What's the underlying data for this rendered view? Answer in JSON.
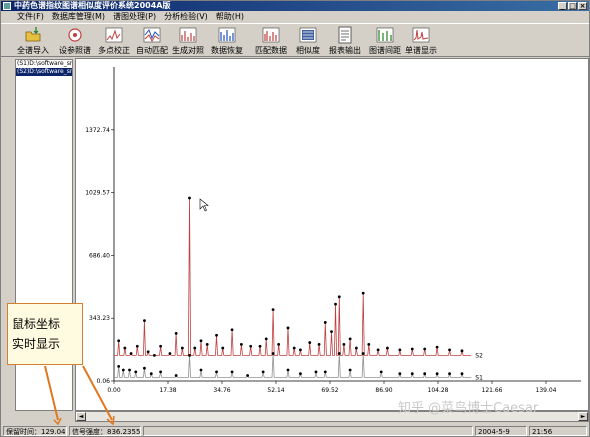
{
  "window": {
    "title": "中药色谱指纹图谱相似度评价系统2004A版"
  },
  "menu": [
    "文件(F)",
    "数据库管理(M)",
    "谱图处理(P)",
    "分析检验(V)",
    "帮助(H)"
  ],
  "toolbar": [
    {
      "label": "全谱导入",
      "icon": "import-icon"
    },
    {
      "label": "设参照谱",
      "icon": "reference-icon"
    },
    {
      "label": "多点校正",
      "icon": "multipoint-correction-icon"
    },
    {
      "label": "自动匹配",
      "icon": "auto-match-icon"
    },
    {
      "label": "生成对照",
      "icon": "generate-reference-icon"
    },
    {
      "label": "数据恢复",
      "icon": "data-restore-icon"
    },
    {
      "label": "匹配数据",
      "icon": "match-data-icon"
    },
    {
      "label": "相似度",
      "icon": "similarity-icon"
    },
    {
      "label": "报表输出",
      "icon": "report-output-icon"
    },
    {
      "label": "图谱间距",
      "icon": "spectrum-spacing-icon"
    },
    {
      "label": "单谱显示",
      "icon": "single-spectrum-icon"
    }
  ],
  "files": [
    "(S1)D:\\software_sr",
    "(S2)D:\\software_sr"
  ],
  "status": {
    "retention_time_label": "保留时间：",
    "retention_time": "129.0429",
    "signal_label": "信号强度：",
    "signal": "836.2355",
    "date": "2004-5-9",
    "time": "21:56"
  },
  "callout": {
    "line1": "鼠标坐标",
    "line2": "实时显示"
  },
  "watermark": "知乎 @菜鸟博士Caesar",
  "colors": {
    "s2_line": "#c04040",
    "s1_line": "#909090",
    "accent": "#0a246a"
  },
  "chart_data": {
    "type": "line",
    "xlabel": "",
    "ylabel": "",
    "x_ticks": [
      "0.00",
      "17.38",
      "34.76",
      "52.14",
      "69.52",
      "86.90",
      "104.28",
      "121.66",
      "139.04"
    ],
    "y_ticks": [
      "0.06",
      "343.23",
      "686.40",
      "1029.57",
      "1372.74"
    ],
    "xlim": [
      0,
      139.04
    ],
    "ylim": [
      0.06,
      1716
    ],
    "series": [
      {
        "name": "S2",
        "peaks": [
          [
            1.5,
            220
          ],
          [
            3.5,
            180
          ],
          [
            5.5,
            150
          ],
          [
            7.5,
            190
          ],
          [
            9.8,
            330
          ],
          [
            11,
            160
          ],
          [
            13,
            140
          ],
          [
            15,
            190
          ],
          [
            18,
            150
          ],
          [
            20,
            260
          ],
          [
            22,
            180
          ],
          [
            24.3,
            1000
          ],
          [
            26,
            180
          ],
          [
            28,
            220
          ],
          [
            30,
            200
          ],
          [
            33,
            250
          ],
          [
            35,
            180
          ],
          [
            38,
            280
          ],
          [
            41,
            200
          ],
          [
            44,
            190
          ],
          [
            47,
            190
          ],
          [
            49,
            230
          ],
          [
            51.2,
            390
          ],
          [
            53,
            200
          ],
          [
            56,
            290
          ],
          [
            58,
            180
          ],
          [
            60,
            170
          ],
          [
            63,
            210
          ],
          [
            66,
            200
          ],
          [
            68,
            320
          ],
          [
            70,
            270
          ],
          [
            71.3,
            420
          ],
          [
            72.5,
            460
          ],
          [
            74,
            200
          ],
          [
            76,
            230
          ],
          [
            78,
            180
          ],
          [
            80.2,
            480
          ],
          [
            82,
            200
          ],
          [
            85,
            170
          ],
          [
            88,
            180
          ],
          [
            92,
            170
          ],
          [
            96,
            175
          ],
          [
            100,
            175
          ],
          [
            104,
            185
          ],
          [
            108,
            170
          ],
          [
            112,
            165
          ]
        ],
        "baseline": 140
      },
      {
        "name": "S1",
        "peaks": [
          [
            1.5,
            80
          ],
          [
            3,
            60
          ],
          [
            5,
            60
          ],
          [
            7,
            50
          ],
          [
            9.8,
            70
          ],
          [
            12,
            40
          ],
          [
            15,
            50
          ],
          [
            20,
            30
          ],
          [
            24.3,
            140
          ],
          [
            28,
            60
          ],
          [
            33,
            50
          ],
          [
            38,
            50
          ],
          [
            43,
            30
          ],
          [
            48,
            50
          ],
          [
            51.2,
            150
          ],
          [
            56,
            60
          ],
          [
            60,
            40
          ],
          [
            65,
            50
          ],
          [
            68,
            50
          ],
          [
            72.5,
            150
          ],
          [
            76,
            60
          ],
          [
            80.2,
            150
          ],
          [
            86,
            50
          ],
          [
            92,
            40
          ],
          [
            96,
            40
          ],
          [
            100,
            40
          ],
          [
            104,
            40
          ],
          [
            108,
            40
          ],
          [
            112,
            40
          ]
        ],
        "baseline": 20
      }
    ]
  }
}
